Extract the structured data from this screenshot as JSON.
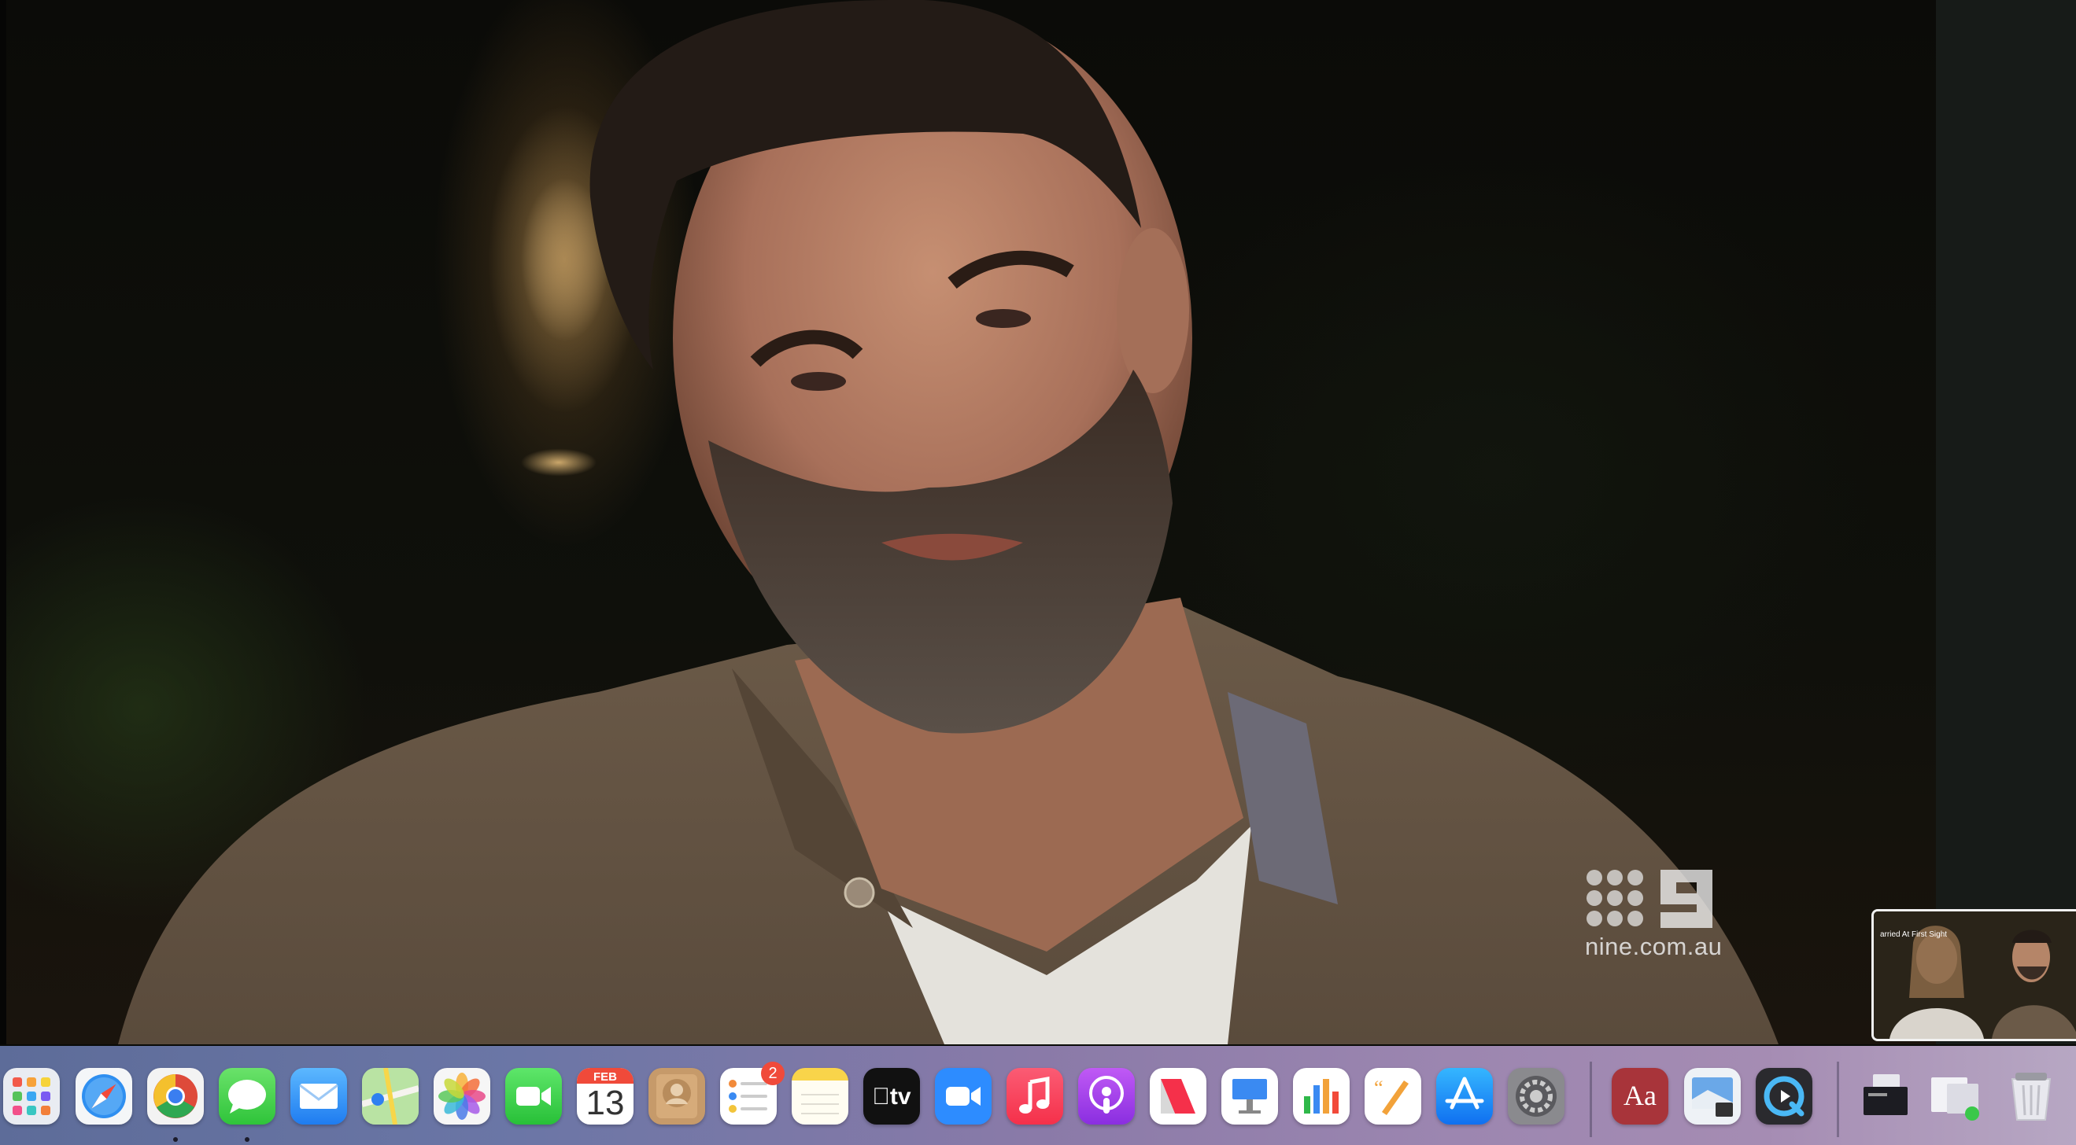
{
  "video": {
    "watermark_site": "nine.com.au"
  },
  "pip": {
    "caption": "arried At First Sight"
  },
  "dock": {
    "apps": [
      {
        "name": "Launchpad",
        "icon": "launchpad-icon"
      },
      {
        "name": "Safari",
        "icon": "safari-icon"
      },
      {
        "name": "Google Chrome",
        "icon": "chrome-icon",
        "running": true
      },
      {
        "name": "Messages",
        "icon": "messages-icon",
        "running": true
      },
      {
        "name": "Mail",
        "icon": "mail-icon"
      },
      {
        "name": "Maps",
        "icon": "maps-icon"
      },
      {
        "name": "Photos",
        "icon": "photos-icon"
      },
      {
        "name": "FaceTime",
        "icon": "facetime-icon"
      },
      {
        "name": "Calendar",
        "icon": "calendar-icon",
        "month": "FEB",
        "day": "13"
      },
      {
        "name": "Contacts",
        "icon": "contacts-icon"
      },
      {
        "name": "Reminders",
        "icon": "reminders-icon",
        "badge": "2"
      },
      {
        "name": "Notes",
        "icon": "notes-icon"
      },
      {
        "name": "TV",
        "icon": "appletv-icon",
        "label": "tv"
      },
      {
        "name": "Zoom",
        "icon": "zoom-icon"
      },
      {
        "name": "Music",
        "icon": "music-icon"
      },
      {
        "name": "Podcasts",
        "icon": "podcasts-icon"
      },
      {
        "name": "News",
        "icon": "news-icon"
      },
      {
        "name": "Keynote",
        "icon": "keynote-icon"
      },
      {
        "name": "Numbers",
        "icon": "numbers-icon"
      },
      {
        "name": "Pages",
        "icon": "pages-icon"
      },
      {
        "name": "App Store",
        "icon": "appstore-icon"
      },
      {
        "name": "System Preferences",
        "icon": "settings-icon"
      },
      {
        "name": "Dictionary",
        "icon": "dictionary-icon",
        "label": "Aa"
      },
      {
        "name": "Preview",
        "icon": "preview-icon"
      },
      {
        "name": "QuickTime Player",
        "icon": "quicktime-icon"
      },
      {
        "name": "Documents Stack",
        "icon": "stack-icon"
      },
      {
        "name": "Screenshots Stack",
        "icon": "stack-icon"
      },
      {
        "name": "Trash",
        "icon": "trash-icon"
      }
    ]
  },
  "colors": {
    "badge": "#f04a3a",
    "dock_gradient_start": "#5d6c99",
    "dock_gradient_end": "#b7a7c3"
  }
}
